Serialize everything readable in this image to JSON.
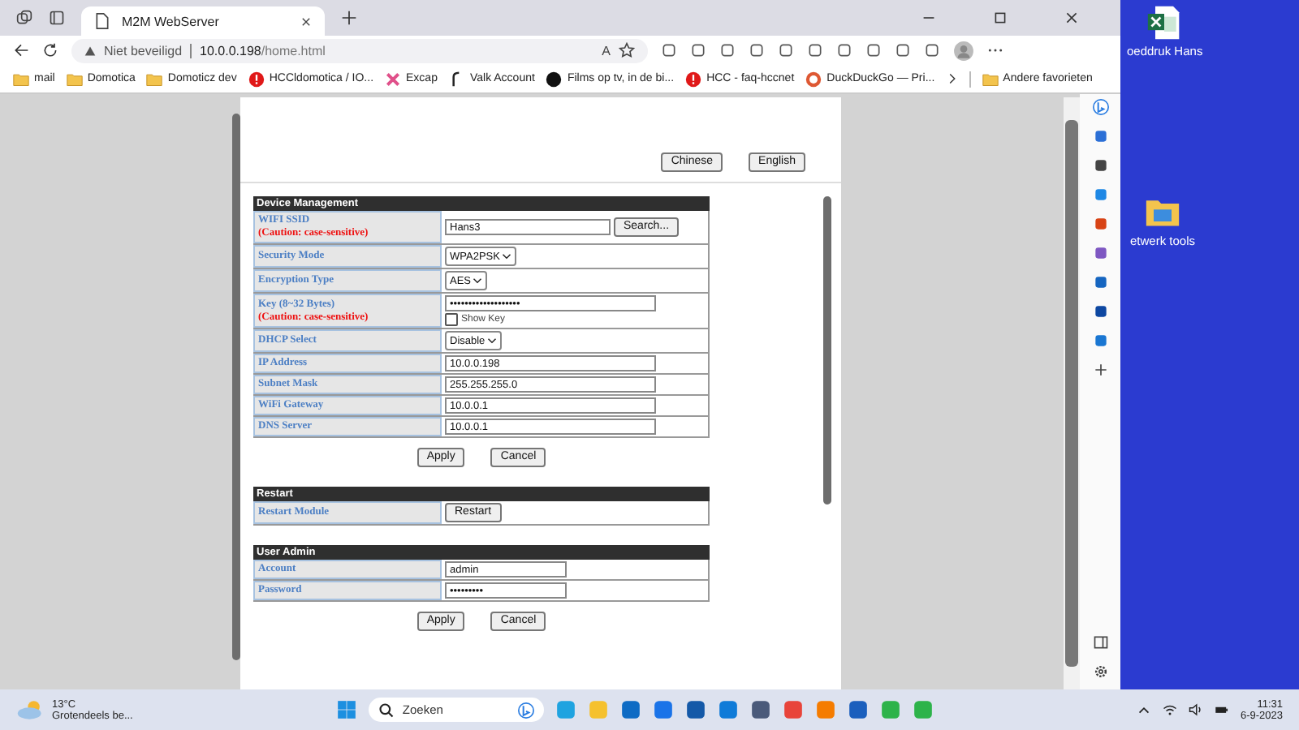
{
  "browser": {
    "tabs": [
      {
        "title": "M2M WebServer",
        "selected": true
      }
    ],
    "address": {
      "security": "Niet beveiligd",
      "host": "10.0.0.198",
      "path": "/home.html"
    },
    "read_aloud": "A",
    "bookmarks": [
      {
        "label": "mail",
        "kind": "folder"
      },
      {
        "label": "Domotica",
        "kind": "folder"
      },
      {
        "label": "Domoticz dev",
        "kind": "folder"
      },
      {
        "label": "HCCldomotica / IO...",
        "kind": "alert"
      },
      {
        "label": "Excap",
        "kind": "cross"
      },
      {
        "label": "Valk Account",
        "kind": "mark"
      },
      {
        "label": "Films op tv, in de bi...",
        "kind": "dark"
      },
      {
        "label": "HCC - faq-hccnet",
        "kind": "alert"
      },
      {
        "label": "DuckDuckGo — Pri...",
        "kind": "duck"
      }
    ],
    "other_favorites": "Andere favorieten"
  },
  "page": {
    "languages": [
      "Chinese",
      "English"
    ],
    "sections": [
      {
        "title": "Device Management",
        "rows": [
          {
            "label": "WIFI SSID",
            "caution": "(Caution: case-sensitive)",
            "kind": "text",
            "value": "Hans3",
            "button": "Search..."
          },
          {
            "label": "Security Mode",
            "kind": "select",
            "value": "WPA2PSK"
          },
          {
            "label": "Encryption Type",
            "kind": "select",
            "value": "AES"
          },
          {
            "label": "Key (8~32 Bytes)",
            "caution": "(Caution: case-sensitive)",
            "kind": "text",
            "value": "•••••••••••••••••••",
            "show_key": {
              "label": "Show Key",
              "checked": false
            }
          },
          {
            "label": "DHCP Select",
            "kind": "select",
            "value": "Disable"
          },
          {
            "label": "IP Address",
            "kind": "text",
            "value": "10.0.0.198"
          },
          {
            "label": "Subnet Mask",
            "kind": "text",
            "value": "255.255.255.0"
          },
          {
            "label": "WiFi Gateway",
            "kind": "text",
            "value": "10.0.0.1"
          },
          {
            "label": "DNS Server",
            "kind": "text",
            "value": "10.0.0.1"
          }
        ],
        "actions": [
          "Apply",
          "Cancel"
        ]
      },
      {
        "title": "Restart",
        "rows": [
          {
            "label": "Restart Module",
            "kind": "button",
            "button": "Restart"
          }
        ]
      },
      {
        "title": "User Admin",
        "rows": [
          {
            "label": "Account",
            "kind": "text",
            "value": "admin"
          },
          {
            "label": "Password",
            "kind": "text",
            "value": "•••••••••"
          }
        ],
        "actions": [
          "Apply",
          "Cancel"
        ]
      }
    ]
  },
  "desktop_icons": [
    {
      "label": "oeddruk Hans",
      "kind": "sheet"
    },
    {
      "label": "etwerk tools",
      "kind": "folder"
    }
  ],
  "taskbar": {
    "weather": {
      "temp": "13°C",
      "text": "Grotendeels be..."
    },
    "search": {
      "placeholder": "Zoeken"
    },
    "time": "11:31",
    "date": "6-9-2023"
  }
}
